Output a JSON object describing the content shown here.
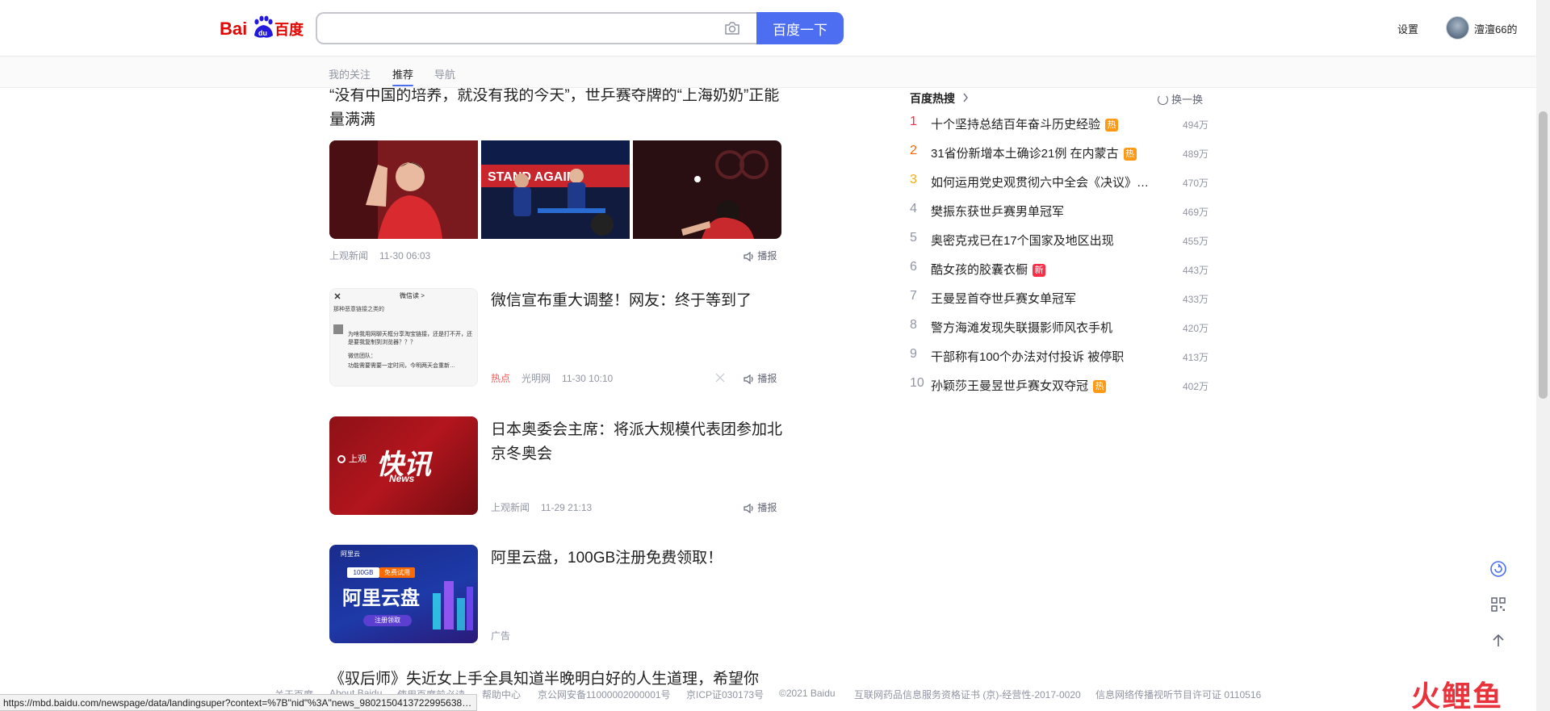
{
  "header": {
    "logo_text": "Bai百度",
    "search_placeholder": "",
    "search_button": "百度一下",
    "settings": "设置",
    "username": "澶澶66的"
  },
  "subnav": {
    "tabs": [
      "我的关注",
      "推荐",
      "导航"
    ],
    "active": "推荐"
  },
  "feed": {
    "item1": {
      "title": "“没有中国的培养，就没有我的今天”，世乒赛夺牌的“上海奶奶”正能量满满",
      "source": "上观新闻",
      "time": "11-30 06:03",
      "broadcast": "播报"
    },
    "item2": {
      "title": "微信宣布重大调整！网友：终于等到了",
      "tag": "热点",
      "source": "光明网",
      "time": "11-30 10:10",
      "broadcast": "播报",
      "thumb_top": "微信读 >",
      "thumb_l1": "那种恶意链接之类的",
      "thumb_l2": "为啥我用网聊天框分享淘宝链接，还是打不开，还是要我复制到浏览器？？？",
      "thumb_l3": "微信团队：",
      "thumb_l4": "功能需要需要一定时间，今明两天会重新…"
    },
    "item3": {
      "title": "日本奥委会主席：将派大规模代表团参加北京冬奥会",
      "source": "上观新闻",
      "time": "11-29 21:13",
      "broadcast": "播报",
      "thumb_brand": "上观",
      "thumb_big": "快讯",
      "thumb_sub": "News"
    },
    "item4": {
      "title": "阿里云盘，100GB注册免费领取！",
      "tag": "广告",
      "thumb_brand": "阿里云",
      "thumb_badge_left": "100GB",
      "thumb_badge_right": "免费试用",
      "thumb_big": "阿里云盘",
      "thumb_btn": "注册领取"
    },
    "item5_partial": "《驭后师》失近女上手全具知道半晚明白好的人生道理，希望你"
  },
  "hot": {
    "heading": "百度热搜",
    "refresh": "换一换",
    "items": [
      {
        "rank": "1",
        "text": "十个坚持总结百年奋斗历史经验",
        "badge": "热",
        "heat": "494万"
      },
      {
        "rank": "2",
        "text": "31省份新增本土确诊21例 在内蒙古",
        "badge": "热",
        "heat": "489万"
      },
      {
        "rank": "3",
        "text": "如何运用党史观贯彻六中全会《决议》…",
        "badge": "",
        "heat": "470万"
      },
      {
        "rank": "4",
        "text": "樊振东获世乒赛男单冠军",
        "badge": "",
        "heat": "469万"
      },
      {
        "rank": "5",
        "text": "奥密克戎已在17个国家及地区出现",
        "badge": "",
        "heat": "455万"
      },
      {
        "rank": "6",
        "text": "酷女孩的胶囊衣橱",
        "badge": "新",
        "heat": "443万"
      },
      {
        "rank": "7",
        "text": "王曼昱首夺世乒赛女单冠军",
        "badge": "",
        "heat": "433万"
      },
      {
        "rank": "8",
        "text": "警方海滩发现失联摄影师风衣手机",
        "badge": "",
        "heat": "420万"
      },
      {
        "rank": "9",
        "text": "干部称有100个办法对付投诉 被停职",
        "badge": "",
        "heat": "413万"
      },
      {
        "rank": "10",
        "text": "孙颖莎王曼昱世乒赛女双夺冠",
        "badge": "热",
        "heat": "402万"
      }
    ]
  },
  "footer": {
    "links": [
      "关于百度",
      "About Baidu",
      "使用百度前必读",
      "帮助中心",
      "京公网安备11000002000001号",
      "京ICP证030173号",
      "©2021 Baidu",
      "互联网药品信息服务资格证书 (京)-经营性-2017-0020",
      "信息网络传播视听节目许可证 0110516"
    ]
  },
  "status_bar_url": "https://mbd.baidu.com/newspage/data/landingsuper?context=%7B\"nid\"%3A\"news_9802150413722995638…",
  "watermark": "火鲤鱼",
  "colors": {
    "accent": "#4e6ef2",
    "rank1": "#fe2d46",
    "rank2": "#f60",
    "rank3": "#faa90e",
    "badge_hot": "#ff9812",
    "badge_new": "#fe2d46"
  }
}
